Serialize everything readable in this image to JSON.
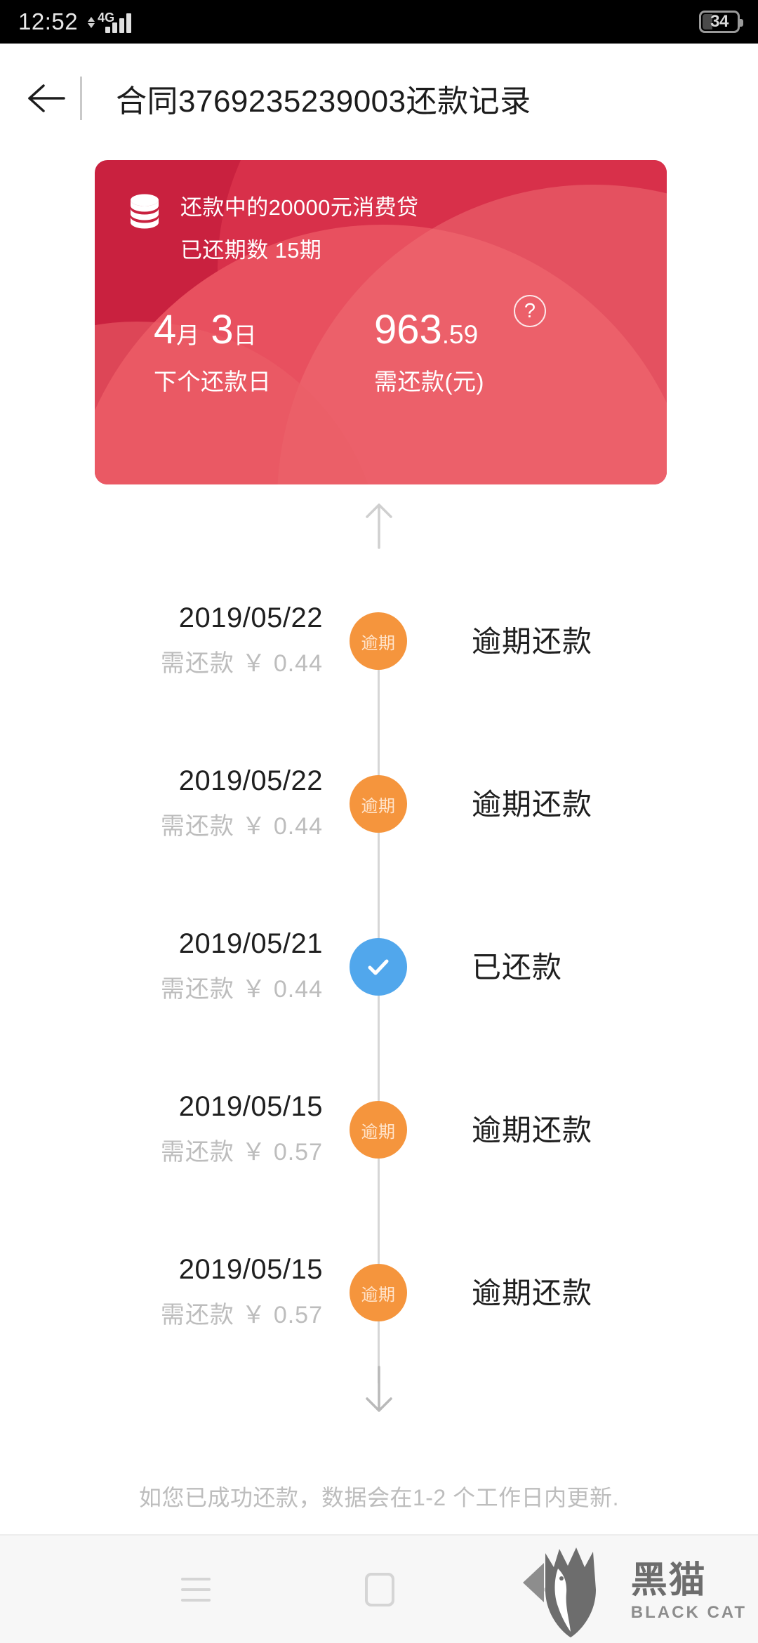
{
  "status_bar": {
    "time": "12:52",
    "network": "4G",
    "battery_level": "34"
  },
  "header": {
    "back_icon": "back-arrow-icon",
    "title": "合同3769235239003还款记录"
  },
  "card": {
    "icon": "coin-stack-icon",
    "product_line": "还款中的20000元消费贷",
    "periods_line": "已还期数 15期",
    "next_date": {
      "month_num": "4",
      "month_unit": "月",
      "day_num": "3",
      "day_unit": "日",
      "label": "下个还款日"
    },
    "amount_due": {
      "integer": "963",
      "decimal": ".59",
      "label": "需还款(元)",
      "help_icon": "?"
    },
    "colors": {
      "base": "#c9213f",
      "highlight": "#e8505f"
    }
  },
  "timeline": {
    "scroll_up_icon": "arrow-up-icon",
    "scroll_down_icon": "arrow-down-icon",
    "rows": [
      {
        "date": "2019/05/22",
        "amount": "需还款 ￥ 0.44",
        "badge": "逾期",
        "status": "逾期还款",
        "state": "overdue"
      },
      {
        "date": "2019/05/22",
        "amount": "需还款 ￥ 0.44",
        "badge": "逾期",
        "status": "逾期还款",
        "state": "overdue"
      },
      {
        "date": "2019/05/21",
        "amount": "需还款 ￥ 0.44",
        "badge": "",
        "status": "已还款",
        "state": "paid"
      },
      {
        "date": "2019/05/15",
        "amount": "需还款 ￥ 0.57",
        "badge": "逾期",
        "status": "逾期还款",
        "state": "overdue"
      },
      {
        "date": "2019/05/15",
        "amount": "需还款 ￥ 0.57",
        "badge": "逾期",
        "status": "逾期还款",
        "state": "overdue"
      }
    ]
  },
  "footer": {
    "note": "如您已成功还款，数据会在1-2 个工作日内更新."
  },
  "nav_bar": {
    "menu_icon": "hamburger-menu-icon",
    "home_icon": "home-icon",
    "back_icon": "back-triangle-icon"
  },
  "watermark": {
    "cn": "黑猫",
    "en": "BLACK CAT",
    "logo_icon": "black-cat-logo-icon"
  }
}
